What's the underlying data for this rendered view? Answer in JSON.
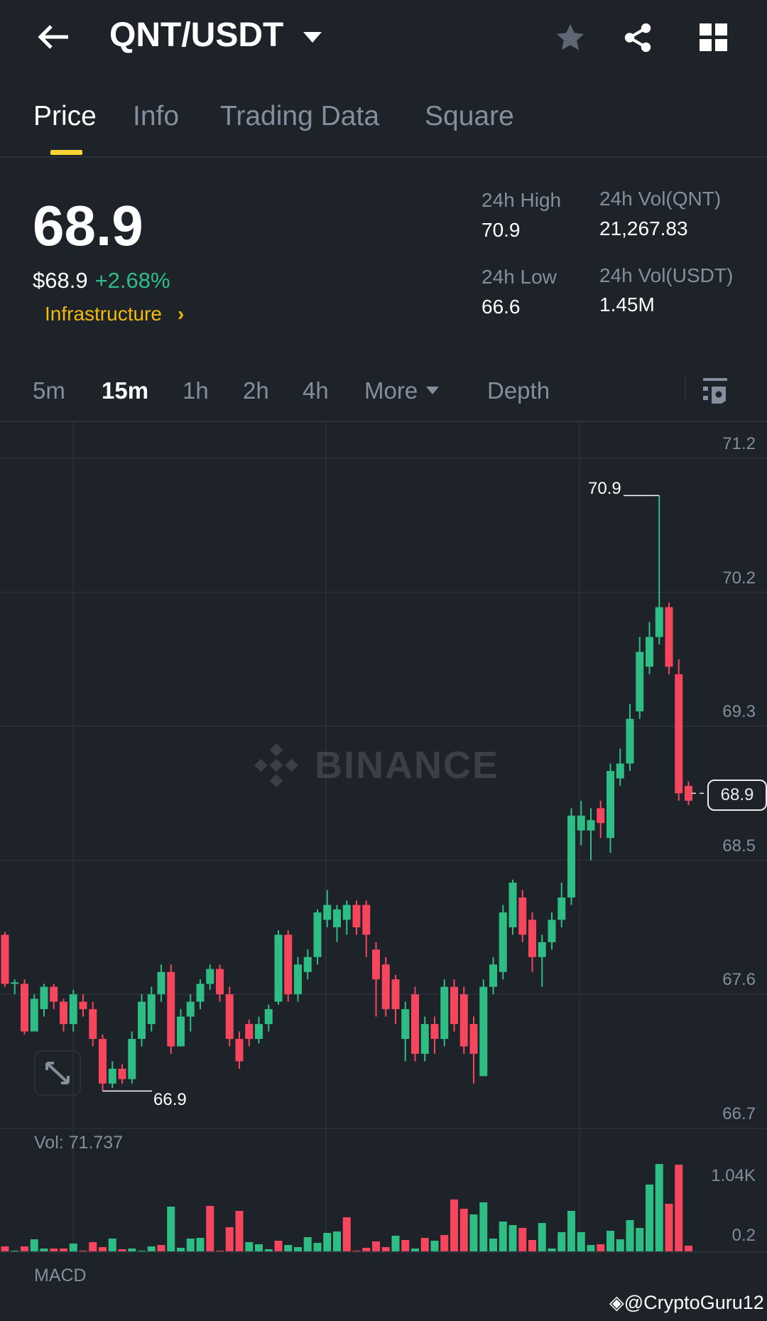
{
  "header": {
    "title": "QNT/USDT",
    "back": "back-arrow-icon",
    "star": "star-icon",
    "share": "share-icon",
    "menu": "grid-icon"
  },
  "tabs": [
    {
      "label": "Price"
    },
    {
      "label": "Info"
    },
    {
      "label": "Trading Data"
    },
    {
      "label": "Square"
    }
  ],
  "ticker": {
    "price": "68.9",
    "usd_price": "$68.9",
    "change": "+2.68%",
    "sector": "Infrastructure",
    "sector_chevron": "›",
    "high_label": "24h High",
    "high": "70.9",
    "low_label": "24h Low",
    "low": "66.6",
    "vol_qnt_label": "24h Vol(QNT)",
    "vol_qnt": "21,267.83",
    "vol_usdt_label": "24h Vol(USDT)",
    "vol_usdt": "1.45M"
  },
  "intervals": [
    {
      "label": "5m"
    },
    {
      "label": "15m"
    },
    {
      "label": "1h"
    },
    {
      "label": "2h"
    },
    {
      "label": "4h"
    },
    {
      "label": "More"
    },
    {
      "label": "Depth"
    }
  ],
  "colors": {
    "up": "#2ebd85",
    "down": "#f6465d",
    "accent": "#fcd535",
    "bg": "#1e2329"
  },
  "chart_data": {
    "type": "candlestick",
    "watermark": "BINANCE",
    "y_ticks": [
      "71.2",
      "70.2",
      "69.3",
      "68.5",
      "67.6",
      "66.7"
    ],
    "y_tick_values": [
      71.15,
      70.25,
      69.35,
      68.45,
      67.55,
      66.65
    ],
    "high_marker": "70.9",
    "low_marker": "66.9",
    "current_label": "68.9",
    "current": 68.9,
    "candles": [
      [
        67.95,
        67.97,
        67.6,
        67.62
      ],
      [
        67.62,
        67.65,
        67.55,
        67.63
      ],
      [
        67.62,
        67.65,
        67.28,
        67.3
      ],
      [
        67.3,
        67.55,
        67.3,
        67.52
      ],
      [
        67.45,
        67.62,
        67.4,
        67.6
      ],
      [
        67.6,
        67.62,
        67.45,
        67.5
      ],
      [
        67.5,
        67.52,
        67.3,
        67.35
      ],
      [
        67.35,
        67.58,
        67.3,
        67.55
      ],
      [
        67.5,
        67.55,
        67.4,
        67.45
      ],
      [
        67.45,
        67.5,
        67.2,
        67.25
      ],
      [
        67.25,
        67.28,
        66.9,
        66.95
      ],
      [
        66.95,
        67.1,
        66.92,
        67.05
      ],
      [
        67.05,
        67.08,
        66.95,
        66.98
      ],
      [
        66.98,
        67.3,
        66.95,
        67.25
      ],
      [
        67.25,
        67.55,
        67.2,
        67.5
      ],
      [
        67.35,
        67.6,
        67.3,
        67.55
      ],
      [
        67.55,
        67.75,
        67.5,
        67.7
      ],
      [
        67.7,
        67.75,
        67.15,
        67.2
      ],
      [
        67.2,
        67.45,
        67.2,
        67.4
      ],
      [
        67.4,
        67.55,
        67.3,
        67.5
      ],
      [
        67.5,
        67.65,
        67.45,
        67.62
      ],
      [
        67.62,
        67.75,
        67.58,
        67.72
      ],
      [
        67.72,
        67.75,
        67.5,
        67.55
      ],
      [
        67.55,
        67.6,
        67.2,
        67.25
      ],
      [
        67.25,
        67.3,
        67.05,
        67.1
      ],
      [
        67.35,
        67.38,
        67.2,
        67.25
      ],
      [
        67.25,
        67.4,
        67.22,
        67.35
      ],
      [
        67.35,
        67.48,
        67.3,
        67.45
      ],
      [
        67.5,
        67.98,
        67.48,
        67.95
      ],
      [
        67.95,
        67.98,
        67.5,
        67.55
      ],
      [
        67.55,
        67.8,
        67.5,
        67.75
      ],
      [
        67.7,
        67.85,
        67.65,
        67.8
      ],
      [
        67.8,
        68.12,
        67.75,
        68.1
      ],
      [
        68.05,
        68.25,
        68.0,
        68.15
      ],
      [
        68.0,
        68.15,
        67.9,
        68.12
      ],
      [
        68.05,
        68.18,
        67.95,
        68.15
      ],
      [
        68.15,
        68.18,
        67.95,
        68.0
      ],
      [
        68.15,
        68.18,
        67.8,
        67.95
      ],
      [
        67.85,
        67.9,
        67.4,
        67.65
      ],
      [
        67.75,
        67.8,
        67.4,
        67.45
      ],
      [
        67.65,
        67.68,
        67.35,
        67.45
      ],
      [
        67.25,
        67.5,
        67.1,
        67.45
      ],
      [
        67.55,
        67.6,
        67.1,
        67.15
      ],
      [
        67.15,
        67.4,
        67.1,
        67.35
      ],
      [
        67.35,
        67.4,
        67.15,
        67.25
      ],
      [
        67.25,
        67.65,
        67.2,
        67.6
      ],
      [
        67.6,
        67.65,
        67.3,
        67.35
      ],
      [
        67.55,
        67.6,
        67.15,
        67.2
      ],
      [
        67.35,
        67.4,
        66.95,
        67.15
      ],
      [
        67.0,
        67.65,
        67.0,
        67.6
      ],
      [
        67.6,
        67.8,
        67.55,
        67.75
      ],
      [
        67.7,
        68.15,
        67.65,
        68.1
      ],
      [
        68.0,
        68.32,
        67.95,
        68.3
      ],
      [
        68.2,
        68.25,
        67.9,
        67.95
      ],
      [
        68.05,
        68.1,
        67.7,
        67.8
      ],
      [
        67.8,
        67.95,
        67.6,
        67.9
      ],
      [
        67.9,
        68.1,
        67.85,
        68.05
      ],
      [
        68.05,
        68.3,
        68.0,
        68.2
      ],
      [
        68.2,
        68.8,
        68.15,
        68.75
      ],
      [
        68.65,
        68.85,
        68.55,
        68.75
      ],
      [
        68.65,
        68.8,
        68.45,
        68.72
      ],
      [
        68.8,
        68.85,
        68.6,
        68.7
      ],
      [
        68.6,
        69.1,
        68.5,
        69.05
      ],
      [
        69.0,
        69.2,
        68.95,
        69.1
      ],
      [
        69.1,
        69.5,
        69.05,
        69.4
      ],
      [
        69.45,
        69.95,
        69.4,
        69.85
      ],
      [
        69.75,
        70.05,
        69.7,
        69.95
      ],
      [
        69.95,
        70.9,
        69.9,
        70.15
      ],
      [
        70.15,
        70.18,
        69.7,
        69.75
      ],
      [
        69.7,
        69.8,
        68.85,
        68.9
      ],
      [
        68.95,
        68.98,
        68.82,
        68.85
      ]
    ],
    "volume_label": "Vol: 71.737",
    "volume_ticks": [
      "1.04K",
      "0.2"
    ],
    "volume_tick_values": [
      1.04,
      0.2
    ],
    "volumes": [
      0.07,
      0.01,
      0.07,
      0.17,
      0.04,
      0.04,
      0.04,
      0.11,
      0.01,
      0.13,
      0.06,
      0.18,
      0.03,
      0.04,
      0.01,
      0.07,
      0.09,
      0.63,
      0.05,
      0.18,
      0.19,
      0.64,
      0.01,
      0.34,
      0.57,
      0.13,
      0.1,
      0.03,
      0.15,
      0.09,
      0.06,
      0.2,
      0.12,
      0.26,
      0.28,
      0.48,
      0.01,
      0.05,
      0.14,
      0.06,
      0.22,
      0.16,
      0.04,
      0.19,
      0.15,
      0.23,
      0.73,
      0.6,
      0.52,
      0.69,
      0.18,
      0.42,
      0.37,
      0.33,
      0.16,
      0.4,
      0.04,
      0.27,
      0.57,
      0.27,
      0.09,
      0.1,
      0.29,
      0.17,
      0.44,
      0.33,
      0.94,
      1.23,
      0.67,
      1.22,
      0.08
    ],
    "volume_colors": "rgrggrrgrrrgrgggrggggrrrrgggrggggggrrrrrgrgrgrrrgggggrrggggggrggggggrrr",
    "indicator_label": "MACD"
  },
  "watermark_user": "@CryptoGuru12"
}
